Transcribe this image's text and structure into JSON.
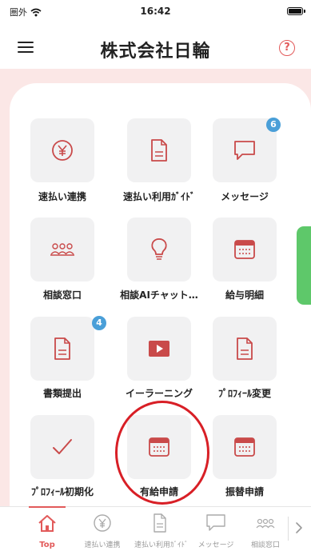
{
  "status_bar": {
    "carrier": "圏外",
    "time": "16:42"
  },
  "header": {
    "menu_icon": "hamburger-icon",
    "title": "株式会社日輪",
    "help_label": "?"
  },
  "colors": {
    "accent": "#e25a5a",
    "tile_bg": "#f1f1f2",
    "band_bg": "#fbe7e6",
    "badge": "#4a9fd8",
    "side_tab": "#5ec86a",
    "highlight_circle": "#d81f26"
  },
  "menu": {
    "items": [
      {
        "label": "速払い連携",
        "icon": "yen-circle-icon",
        "badge": ""
      },
      {
        "label": "速払い利用ｶﾞｲﾄﾞ",
        "icon": "document-icon",
        "badge": ""
      },
      {
        "label": "メッセージ",
        "icon": "chat-bubble-icon",
        "badge": "6"
      },
      {
        "label": "相談窓口",
        "icon": "people-icon",
        "badge": ""
      },
      {
        "label": "相談AIチャット…",
        "icon": "lightbulb-icon",
        "badge": ""
      },
      {
        "label": "給与明細",
        "icon": "calendar-icon",
        "badge": ""
      },
      {
        "label": "書類提出",
        "icon": "document-icon",
        "badge": "4"
      },
      {
        "label": "イーラーニング",
        "icon": "play-video-icon",
        "badge": ""
      },
      {
        "label": "ﾌﾟﾛﾌｨｰﾙ変更",
        "icon": "document-icon",
        "badge": ""
      },
      {
        "label": "ﾌﾟﾛﾌｨｰﾙ初期化",
        "icon": "checkmark-icon",
        "badge": ""
      },
      {
        "label": "有給申請",
        "icon": "calendar-icon",
        "badge": ""
      },
      {
        "label": "振替申請",
        "icon": "calendar-icon",
        "badge": ""
      }
    ]
  },
  "bottom_nav": {
    "items": [
      {
        "label": "Top",
        "icon": "home-icon",
        "active": true
      },
      {
        "label": "速払い連携",
        "icon": "yen-circle-icon",
        "active": false
      },
      {
        "label": "速払い利用ｶﾞｲﾄﾞ",
        "icon": "document-icon",
        "active": false
      },
      {
        "label": "メッセージ",
        "icon": "chat-bubble-icon",
        "active": false
      },
      {
        "label": "相談窓口",
        "icon": "people-icon",
        "active": false
      }
    ],
    "more_icon": "chevron-right-icon"
  }
}
